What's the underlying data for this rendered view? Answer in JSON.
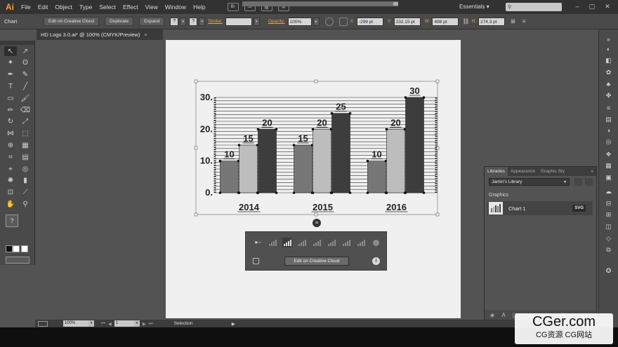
{
  "app": {
    "logo_text": "Ai",
    "menu": [
      "File",
      "Edit",
      "Object",
      "Type",
      "Select",
      "Effect",
      "View",
      "Window",
      "Help"
    ],
    "workspace": "Essentials",
    "search_placeholder": "",
    "accent": "#f7a233"
  },
  "controlbar": {
    "selection_label": "Chart",
    "edit_cc_label": "Edit on Creative Cloud",
    "duplicate_label": "Duplicate",
    "expand_label": "Expand",
    "stroke_label": "Stroke:",
    "opacity_label": "Opacity:",
    "opacity_value": "100%",
    "x_label": "X:",
    "x_value": "-299 pt",
    "y_label": "Y:",
    "y_value": "232.15 pt",
    "w_label": "W:",
    "w_value": "498 pt",
    "h_label": "H:",
    "h_value": "274.3 pt"
  },
  "document": {
    "tab_title": "HD Logo 3.0.ai* @ 100% (CMYK/Preview)",
    "tab_close": "×",
    "artboard_color": "#f0f0f0"
  },
  "chart_data": {
    "type": "bar",
    "categories": [
      "2014",
      "2015",
      "2016"
    ],
    "series": [
      {
        "values": [
          10,
          15,
          10
        ],
        "color": "#777777"
      },
      {
        "values": [
          15,
          20,
          20
        ],
        "color": "#bdbdbd"
      },
      {
        "values": [
          20,
          25,
          30
        ],
        "color": "#3d3d3d"
      }
    ],
    "yticks": [
      "0",
      "10",
      "20",
      "30"
    ],
    "ylim": [
      0,
      30
    ],
    "grid": true,
    "data_labels": true
  },
  "chart_panel": {
    "edit_label": "Edit on Creative Cloud",
    "info_icon": "i",
    "menu_icon": "≡",
    "icons": [
      "pin-icon",
      "list-chart-icon",
      "bar-chart-icon",
      "area-bar-icon",
      "stacked-bar-icon",
      "horizontal-bar-icon",
      "line-chart-icon",
      "area-chart-icon",
      "pie-chart-icon"
    ]
  },
  "libraries": {
    "tabs": [
      "Libraries",
      "Appearance",
      "Graphic Sty"
    ],
    "more": "»",
    "library_name": "Jamin's Library",
    "section": "Graphics",
    "items": [
      {
        "name": "Chart 1",
        "badge": "SVG"
      }
    ]
  },
  "statusbar": {
    "zoom": "100%",
    "page": "1",
    "tool": "Selection"
  },
  "watermark": {
    "main": "CGer.com",
    "sub": "CG资源 CG网站"
  }
}
